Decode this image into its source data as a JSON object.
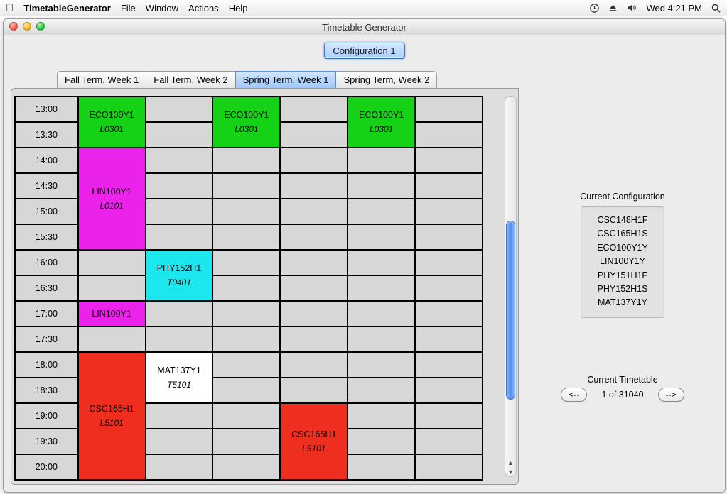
{
  "menubar": {
    "app": "TimetableGenerator",
    "items": [
      "File",
      "Window",
      "Actions",
      "Help"
    ],
    "clock": "Wed 4:21 PM"
  },
  "window": {
    "title": "Timetable Generator"
  },
  "config_tab": "Configuration 1",
  "tabs": [
    {
      "label": "Fall Term, Week 1",
      "active": false
    },
    {
      "label": "Fall Term, Week 2",
      "active": false
    },
    {
      "label": "Spring Term, Week 1",
      "active": true
    },
    {
      "label": "Spring Term, Week 2",
      "active": false
    }
  ],
  "times": [
    "13:00",
    "13:30",
    "14:00",
    "14:30",
    "15:00",
    "15:30",
    "16:00",
    "16:30",
    "17:00",
    "17:30",
    "18:00",
    "18:30",
    "19:00",
    "19:30",
    "20:00"
  ],
  "courses": {
    "eco": {
      "code": "ECO100Y1",
      "section": "L0301",
      "color": "green"
    },
    "lin1": {
      "code": "LIN100Y1",
      "section": "L0101",
      "color": "magenta"
    },
    "lin2": {
      "code": "LIN100Y1",
      "section": "",
      "color": "magenta"
    },
    "phy": {
      "code": "PHY152H1",
      "section": "T0401",
      "color": "cyan"
    },
    "mat": {
      "code": "MAT137Y1",
      "section": "T5101",
      "color": "white"
    },
    "csc1": {
      "code": "CSC165H1",
      "section": "L5101",
      "color": "red"
    },
    "csc2": {
      "code": "CSC165H1",
      "section": "L5101",
      "color": "red"
    }
  },
  "blocks": [
    {
      "course": "eco",
      "col": 0,
      "row": 0,
      "span": 2
    },
    {
      "course": "eco",
      "col": 2,
      "row": 0,
      "span": 2
    },
    {
      "course": "eco",
      "col": 4,
      "row": 0,
      "span": 2
    },
    {
      "course": "lin1",
      "col": 0,
      "row": 2,
      "span": 4
    },
    {
      "course": "phy",
      "col": 1,
      "row": 6,
      "span": 2
    },
    {
      "course": "lin2",
      "col": 0,
      "row": 8,
      "span": 1
    },
    {
      "course": "csc1",
      "col": 0,
      "row": 10,
      "span": 5
    },
    {
      "course": "mat",
      "col": 1,
      "row": 10,
      "span": 2
    },
    {
      "course": "csc2",
      "col": 3,
      "row": 12,
      "span": 3
    }
  ],
  "grid": {
    "cols": 6,
    "rows": 15
  },
  "sidebar": {
    "config_title": "Current Configuration",
    "config_courses": [
      "CSC148H1F",
      "CSC165H1S",
      "ECO100Y1Y",
      "LIN100Y1Y",
      "PHY151H1F",
      "PHY152H1S",
      "MAT137Y1Y"
    ],
    "nav_title": "Current Timetable",
    "prev": "<--",
    "next": "-->",
    "counter": "1 of 31040"
  }
}
